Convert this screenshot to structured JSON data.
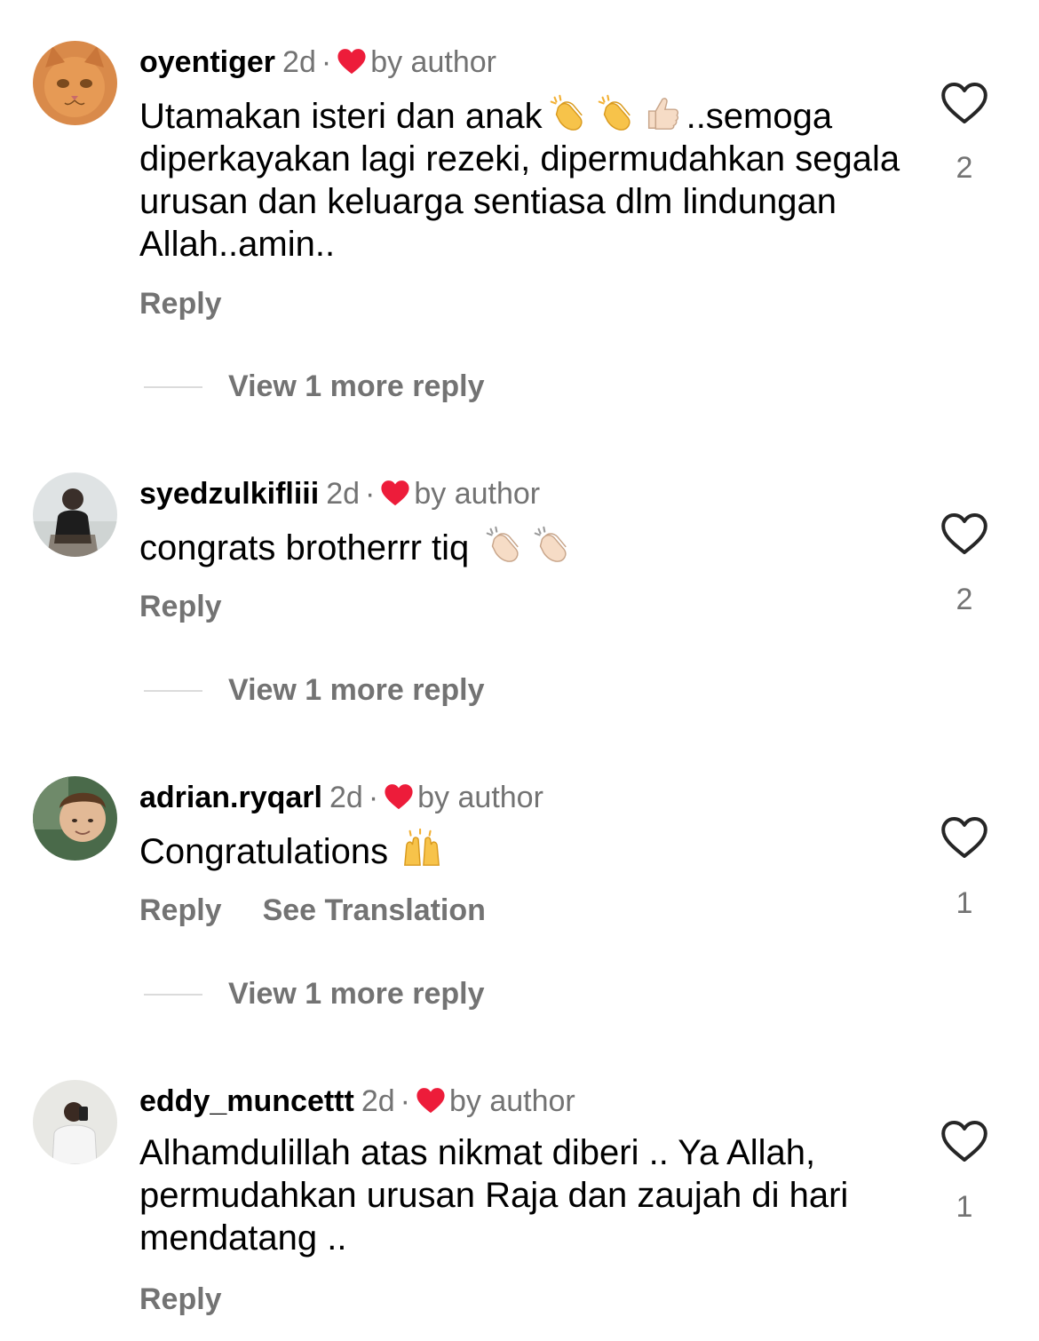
{
  "colors": {
    "heart": "#ed1c3a",
    "muted": "#737373",
    "text": "#000000",
    "divider": "#dbdbdb"
  },
  "comments": [
    {
      "user": "oyentiger",
      "time": "2d",
      "dot": "·",
      "by_author": "by author",
      "text_before": "Utamakan isteri dan anak",
      "emojis": [
        "clapping-hands-emoji",
        "clapping-hands-emoji",
        "thumbs-up-emoji"
      ],
      "text_after": "..semoga diperkayakan lagi rezeki, dipermudahkan segala urusan dan keluarga sentiasa dlm lindungan Allah..amin..",
      "reply": "Reply",
      "likes": "2",
      "view_more": "View 1 more reply"
    },
    {
      "user": "syedzulkifliii",
      "time": "2d",
      "dot": "·",
      "by_author": "by author",
      "text_before": "congrats brotherrr tiq ",
      "emojis": [
        "clapping-hands-emoji",
        "clapping-hands-emoji"
      ],
      "reply": "Reply",
      "likes": "2",
      "view_more": "View 1 more reply"
    },
    {
      "user": "adrian.ryqarl",
      "time": "2d",
      "dot": "·",
      "by_author": "by author",
      "text_before": "Congratulations ",
      "emojis": [
        "raising-hands-emoji"
      ],
      "reply": "Reply",
      "see_translation": "See Translation",
      "likes": "1",
      "view_more": "View 1 more reply"
    },
    {
      "user": "eddy_muncettt",
      "time": "2d",
      "dot": "·",
      "by_author": "by author",
      "text_before": "Alhamdulillah atas nikmat diberi .. Ya Allah, permudahkan urusan Raja dan zaujah di hari mendatang ..",
      "reply": "Reply",
      "likes": "1"
    }
  ]
}
